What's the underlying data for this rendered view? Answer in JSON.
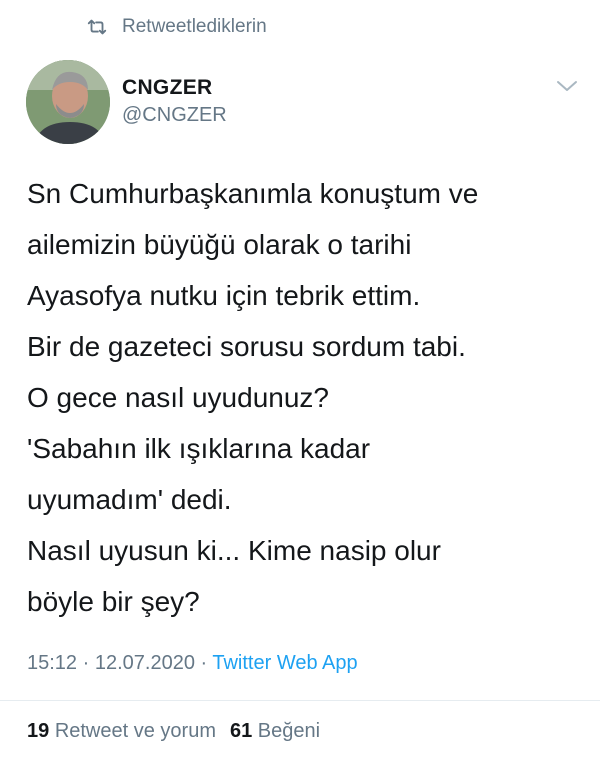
{
  "retweet_context": {
    "label": "Retweetlediklerin",
    "icon": "retweet-icon"
  },
  "author": {
    "display_name": "CNGZER",
    "username": "@CNGZER"
  },
  "tweet": {
    "lines": [
      "Sn Cumhurbaşkanımla konuştum ve",
      "ailemizin büyüğü olarak o tarihi",
      "Ayasofya nutku için tebrik ettim.",
      "Bir de gazeteci sorusu sordum tabi.",
      "O gece nasıl uyudunuz?",
      "'Sabahın ilk ışıklarına kadar",
      "uyumadım' dedi.",
      "Nasıl uyusun ki... Kime nasip olur",
      "böyle bir şey?"
    ]
  },
  "meta": {
    "time": "15:12",
    "separator": " · ",
    "date": "12.07.2020",
    "source": "Twitter Web App"
  },
  "stats": {
    "retweets_count": "19",
    "retweets_label": "Retweet ve yorum",
    "likes_count": "61",
    "likes_label": "Beğeni"
  },
  "colors": {
    "text": "#14171a",
    "secondary": "#657786",
    "link": "#1da1f2",
    "divider": "#e6ecf0"
  }
}
